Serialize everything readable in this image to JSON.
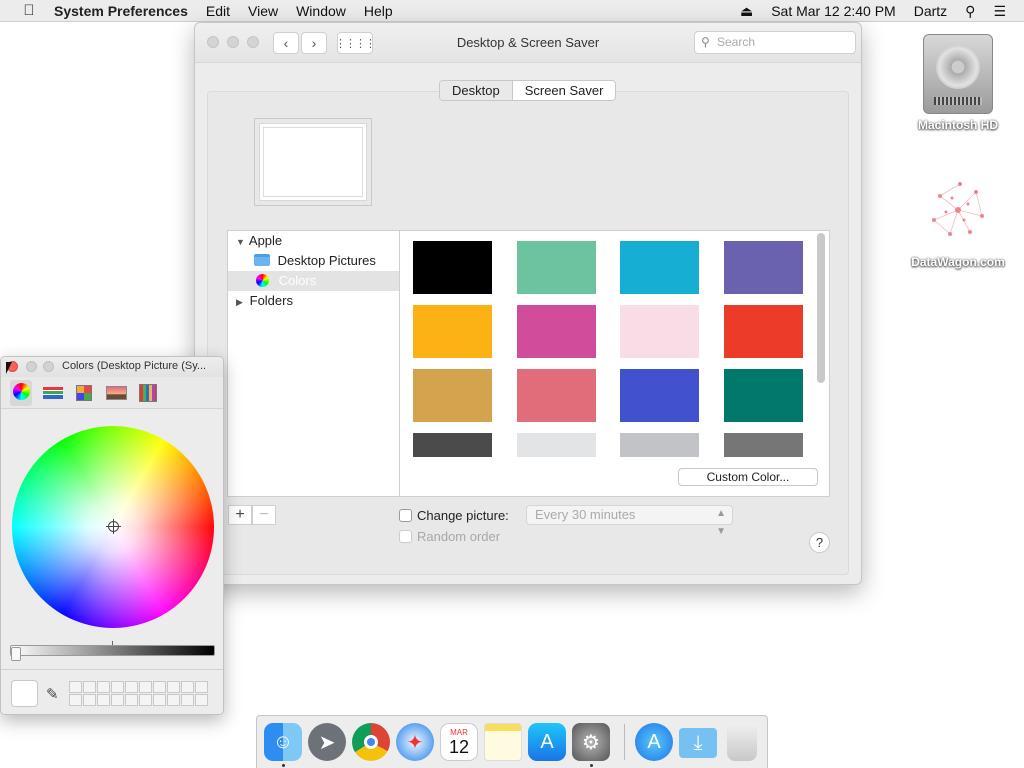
{
  "menubar": {
    "app": "System Preferences",
    "items": [
      "Edit",
      "View",
      "Window",
      "Help"
    ],
    "datetime": "Sat Mar 12  2:40 PM",
    "user": "Dartz"
  },
  "desktop": {
    "icons": [
      {
        "label": "Macintosh HD"
      },
      {
        "label": "DataWagon.com"
      }
    ]
  },
  "window": {
    "title": "Desktop & Screen Saver",
    "search_placeholder": "Search",
    "tabs": [
      "Desktop",
      "Screen Saver"
    ],
    "sidebar": {
      "apple": "Apple",
      "desktop_pictures": "Desktop Pictures",
      "colors": "Colors",
      "folders": "Folders"
    },
    "swatches": [
      "#000000",
      "#6cc3a0",
      "#16aed2",
      "#6a62ae",
      "#fcb215",
      "#d14d9c",
      "#f9dde6",
      "#ec3b28",
      "#d4a34e",
      "#e16d7a",
      "#4252cf",
      "#00796b",
      "#4b4b4b",
      "#e3e4e6",
      "#c2c3c6",
      "#767676"
    ],
    "custom_color_label": "Custom Color...",
    "add_label": "+",
    "remove_label": "−",
    "change_picture_label": "Change picture:",
    "interval_value": "Every 30 minutes",
    "random_order_label": "Random order",
    "help_label": "?"
  },
  "colors_panel": {
    "title": "Colors (Desktop Picture (Sy...",
    "current_color": "#ffffff"
  },
  "dock": {
    "apps": [
      "finder",
      "launchpad",
      "chrome",
      "safari",
      "calendar",
      "notes",
      "app-store",
      "system-preferences",
      "app-store-2",
      "downloads",
      "trash"
    ],
    "calendar_month": "MAR",
    "calendar_day": "12"
  }
}
